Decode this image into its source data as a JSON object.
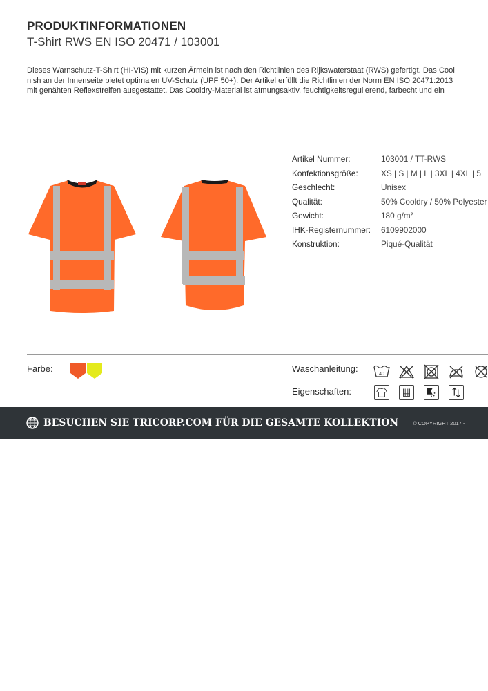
{
  "header": {
    "title": "PRODUKTINFORMATIONEN",
    "subtitle": "T-Shirt RWS EN ISO 20471 / 103001"
  },
  "description": {
    "lines": [
      "Dieses Warnschutz-T-Shirt (HI-VIS) mit kurzen Ärmeln ist nach den Richtlinien des Rijkswaterstaat (RWS) gefertigt. Das Cool",
      "nish an der Innenseite bietet optimalen UV-Schutz (UPF 50+). Der Artikel erfüllt die Richtlinien der Norm EN ISO 20471:2013",
      "mit genähten Reflexstreifen ausgestattet. Das Cooldry-Material ist atmungsaktiv, feuchtigkeitsregulierend, farbecht und ein"
    ]
  },
  "specs": [
    {
      "label": "Artikel Nummer:",
      "value": "103001 / TT-RWS"
    },
    {
      "label": "Konfektionsgröße:",
      "value": "XS | S | M | L | 3XL | 4XL | 5"
    },
    {
      "label": "Geschlecht:",
      "value": "Unisex"
    },
    {
      "label": "Qualität:",
      "value": "50% Cooldry / 50% Polyester"
    },
    {
      "label": "Gewicht:",
      "value": "180 g/m²"
    },
    {
      "label": "IHK-Registernummer:",
      "value": "6109902000"
    },
    {
      "label": "Konstruktion:",
      "value": "Piqué-Qualität"
    }
  ],
  "colors": {
    "label": "Farbe:",
    "swatches": [
      {
        "name": "orange",
        "hex": "#f05a28"
      },
      {
        "name": "yellow",
        "hex": "#e4ea1c"
      }
    ],
    "shirt_fill": "#ff6a2a",
    "reflective": "#b8b8b8",
    "collar": "#1a1a1a"
  },
  "care": {
    "label": "Waschanleitung:",
    "icons": [
      "wash-40-icon",
      "no-bleach-icon",
      "no-tumble-dry-icon",
      "no-iron-icon",
      "no-dry-clean-icon"
    ],
    "wash_temp": "40"
  },
  "properties": {
    "label": "Eigenschaften:",
    "icons": [
      "tshirt-icon",
      "hi-vis-standard-icon",
      "uv-protection-icon",
      "moisture-icon"
    ]
  },
  "footer": {
    "text": "BESUCHEN SIE TRICORP.COM FÜR DIE GESAMTE KOLLEKTION",
    "copyright": "© COPYRIGHT 2017 -",
    "bg": "#2f3438"
  }
}
